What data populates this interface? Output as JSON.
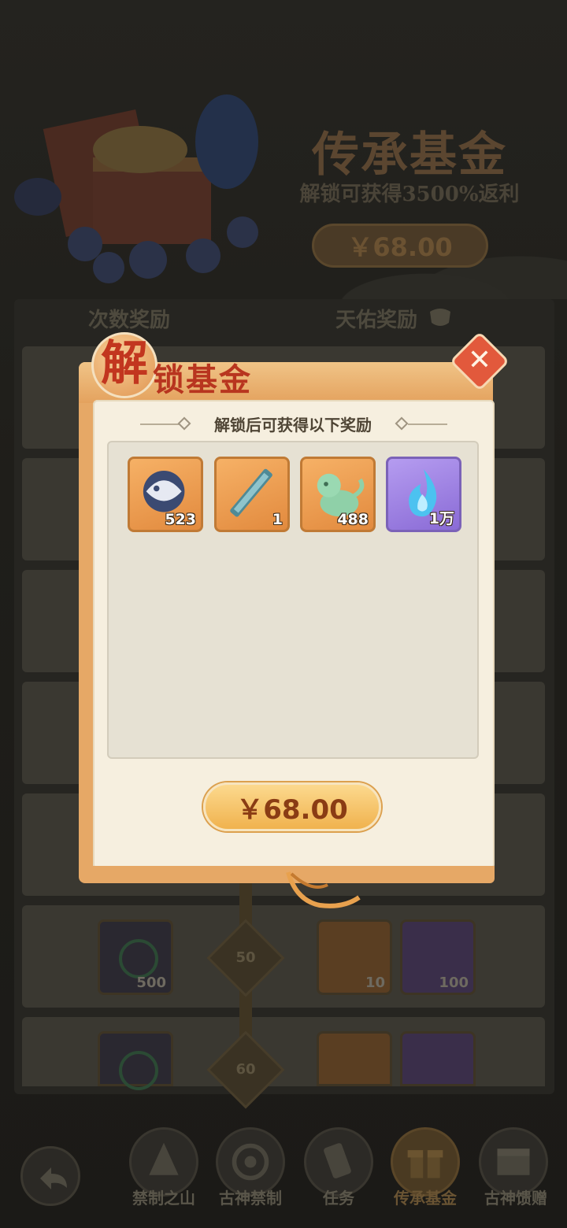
{
  "hero": {
    "title": "传承基金",
    "subtitle": "解锁可获得3500%返利",
    "price": "￥68.00"
  },
  "columns": {
    "left": "次数奖励",
    "right": "天佑奖励"
  },
  "background_rows": [
    {
      "milestone": "50",
      "left_count": "500",
      "right_items": [
        {
          "count": "10",
          "style": "orange"
        },
        {
          "count": "100",
          "style": "purple"
        }
      ]
    },
    {
      "milestone": "60",
      "left_count": "",
      "right_items": [
        {
          "count": "",
          "style": "orange"
        },
        {
          "count": "",
          "style": "purple"
        }
      ]
    }
  ],
  "bottom_nav": [
    {
      "label": "禁制之山",
      "icon": "mountain-icon"
    },
    {
      "label": "古神禁制",
      "icon": "swirl-icon"
    },
    {
      "label": "任务",
      "icon": "scroll-icon"
    },
    {
      "label": "传承基金",
      "icon": "gift-icon",
      "active": true
    },
    {
      "label": "古神馈赠",
      "icon": "chest-icon"
    }
  ],
  "modal": {
    "title_first_char": "解",
    "title_rest": "锁基金",
    "subtitle": "解锁后可获得以下奖励",
    "rewards": [
      {
        "icon": "fish-token-icon",
        "count": "523",
        "style": "orange"
      },
      {
        "icon": "sword-scroll-icon",
        "count": "1",
        "style": "orange"
      },
      {
        "icon": "jade-lion-icon",
        "count": "488",
        "style": "orange"
      },
      {
        "icon": "blue-flame-icon",
        "count": "1万",
        "style": "purple"
      }
    ],
    "price_button": "￥68.00"
  },
  "colors": {
    "modal_orange": "#e6a866",
    "title_red": "#c2361f",
    "close_red": "#e2593c",
    "price_text": "#8a3c14"
  }
}
